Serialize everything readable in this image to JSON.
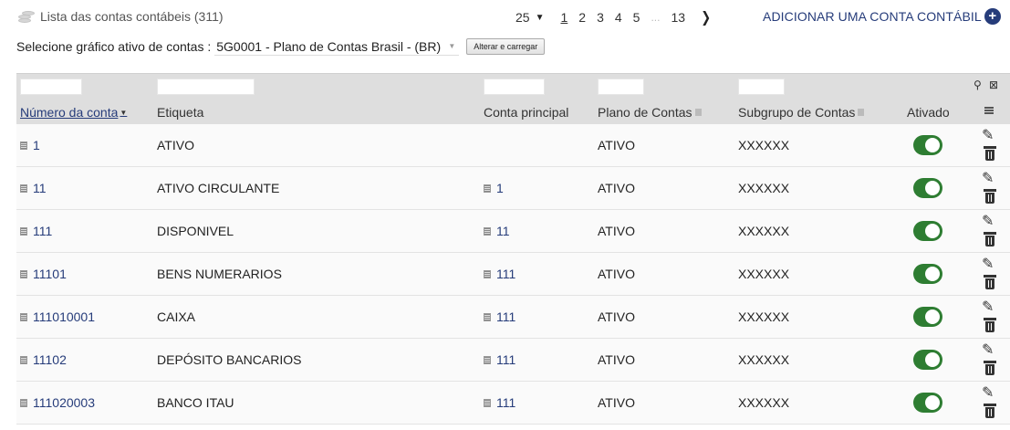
{
  "header": {
    "title": "Lista das contas contábeis (311)",
    "add_label": "ADICIONAR UMA CONTA CONTÁBIL"
  },
  "pagination": {
    "per_page": "25",
    "pages": [
      "1",
      "2",
      "3",
      "4",
      "5"
    ],
    "current": "1",
    "ellipsis": "...",
    "last": "13"
  },
  "chart_selector": {
    "label": "Selecione gráfico ativo de contas :",
    "value": "5G0001 - Plano de Contas Brasil - (BR)",
    "button_label": "Alterar e carregar"
  },
  "table": {
    "columns": {
      "account_number": "Número da conta",
      "label": "Etiqueta",
      "parent": "Conta principal",
      "plan": "Plano de Contas",
      "subgroup": "Subgrupo de Contas",
      "active": "Ativado"
    },
    "rows": [
      {
        "number": "1",
        "label": "ATIVO",
        "parent": "",
        "plan": "ATIVO",
        "subgroup": "XXXXXX",
        "active": true
      },
      {
        "number": "11",
        "label": "ATIVO CIRCULANTE",
        "parent": "1",
        "plan": "ATIVO",
        "subgroup": "XXXXXX",
        "active": true
      },
      {
        "number": "111",
        "label": "DISPONIVEL",
        "parent": "11",
        "plan": "ATIVO",
        "subgroup": "XXXXXX",
        "active": true
      },
      {
        "number": "11101",
        "label": "BENS NUMERARIOS",
        "parent": "111",
        "plan": "ATIVO",
        "subgroup": "XXXXXX",
        "active": true
      },
      {
        "number": "111010001",
        "label": "CAIXA",
        "parent": "111",
        "plan": "ATIVO",
        "subgroup": "XXXXXX",
        "active": true
      },
      {
        "number": "11102",
        "label": "DEPÓSITO BANCARIOS",
        "parent": "111",
        "plan": "ATIVO",
        "subgroup": "XXXXXX",
        "active": true
      },
      {
        "number": "111020003",
        "label": "BANCO ITAU",
        "parent": "111",
        "plan": "ATIVO",
        "subgroup": "XXXXXX",
        "active": true
      }
    ]
  },
  "colors": {
    "accent": "#263c7a",
    "toggle_on": "#2e7d32",
    "header_bg": "#dedede"
  },
  "icons": {
    "title": "coins-icon",
    "add": "plus-circle-icon",
    "next": "chevron-right-icon",
    "search": "search-icon",
    "clear_filter": "clear-filter-icon",
    "columns": "list-icon",
    "edit": "pencil-icon",
    "delete": "trash-icon",
    "account": "document-icon"
  }
}
